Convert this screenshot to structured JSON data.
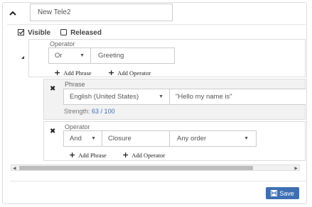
{
  "header": {
    "name_value": "New Tele2"
  },
  "toggles": {
    "visible_label": "Visible",
    "released_label": "Released"
  },
  "operator_root": {
    "label": "Operator",
    "operator_value": "Or",
    "name_value": "Greeting",
    "add_phrase_label": "Add Phrase",
    "add_operator_label": "Add Operator"
  },
  "phrase": {
    "label": "Phrase",
    "language_value": "English (United States)",
    "text_value": "\"Hello my name is\"",
    "strength_label": "Strength:",
    "strength_value": "63 / 100"
  },
  "operator_child": {
    "label": "Operator",
    "operator_value": "And",
    "name_value": "Closure",
    "order_value": "Any order",
    "add_phrase_label": "Add Phrase",
    "add_operator_label": "Add Operator"
  },
  "footer": {
    "save_label": "Save"
  },
  "colors": {
    "accent": "#3d6fb4",
    "strength": "#3d6fb4"
  }
}
